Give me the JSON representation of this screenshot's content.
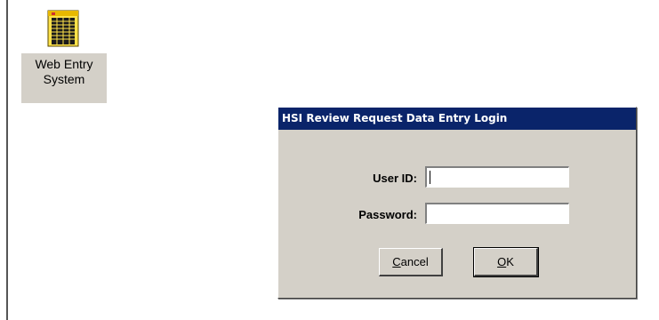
{
  "desktop": {
    "icon": {
      "name": "spreadsheet-icon",
      "label_line1": "Web Entry",
      "label_line2": "System"
    }
  },
  "dialog": {
    "title": "HSI Review Request Data Entry Login",
    "fields": {
      "user_id_label": "User ID:",
      "user_id_value": "",
      "password_label": "Password:",
      "password_value": ""
    },
    "buttons": {
      "cancel_mnemonic": "C",
      "cancel_rest": "ancel",
      "ok_mnemonic": "O",
      "ok_rest": "K"
    }
  },
  "colors": {
    "titlebar": "#0a246a",
    "dialog_face": "#d4d0c8",
    "desktop": "#ffffff"
  }
}
